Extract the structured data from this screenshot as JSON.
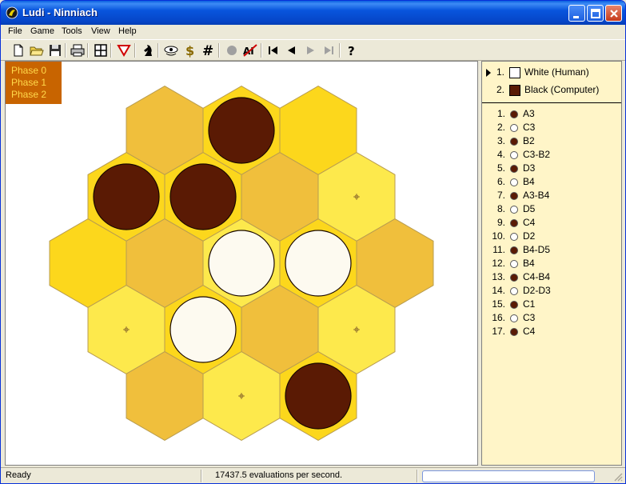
{
  "window": {
    "title": "Ludi - Ninniach"
  },
  "menu": [
    "File",
    "Game",
    "Tools",
    "View",
    "Help"
  ],
  "toolbar": {
    "buttons": [
      {
        "name": "new-button",
        "icon": "new-file-icon"
      },
      {
        "name": "open-button",
        "icon": "open-folder-icon"
      },
      {
        "name": "save-button",
        "icon": "floppy-disk-icon"
      },
      {
        "name": "print-button",
        "icon": "printer-icon"
      },
      {
        "name": "board-button",
        "icon": "grid-board-icon"
      },
      {
        "name": "swap-button",
        "icon": "triangle-down-icon"
      },
      {
        "name": "player-button",
        "icon": "knight-icon"
      },
      {
        "name": "hint-button",
        "icon": "eye-hand-icon"
      },
      {
        "name": "score-button",
        "icon": "dollar-icon"
      },
      {
        "name": "coordinates-button",
        "icon": "hash-icon"
      },
      {
        "name": "stop-button",
        "icon": "stop-circle-icon"
      },
      {
        "name": "ai-off-button",
        "icon": "ai-crossed-icon"
      },
      {
        "name": "first-move-button",
        "icon": "skip-back-icon"
      },
      {
        "name": "prev-move-button",
        "icon": "step-back-icon"
      },
      {
        "name": "next-move-button",
        "icon": "step-forward-icon"
      },
      {
        "name": "last-move-button",
        "icon": "skip-forward-icon"
      },
      {
        "name": "help-button",
        "icon": "question-icon"
      }
    ]
  },
  "phases": [
    "Phase 0",
    "Phase 1",
    "Phase 2"
  ],
  "colors": {
    "hex_light": "#f0bf3c",
    "hex_bright": "#fcd71c",
    "hex_yellow": "#fde94c",
    "hex_border": "#b89c50",
    "black_piece": "#5a1a04",
    "white_piece": "#fdfaf0",
    "phase_bg": "#c86400",
    "phase_text": "#ffd84a",
    "side_bg": "#fff5c8"
  },
  "board": {
    "pieces_note_hidden": "",
    "cells": [
      {
        "id": "c1",
        "shade": "light",
        "piece": "none"
      },
      {
        "id": "c2",
        "shade": "bright",
        "piece": "black"
      },
      {
        "id": "c3",
        "shade": "bright",
        "piece": "none"
      },
      {
        "id": "c4",
        "shade": "bright",
        "piece": "black"
      },
      {
        "id": "c5",
        "shade": "bright",
        "piece": "black"
      },
      {
        "id": "c6",
        "shade": "light",
        "piece": "none"
      },
      {
        "id": "c7",
        "shade": "yellow",
        "piece": "marker"
      },
      {
        "id": "c8",
        "shade": "bright",
        "piece": "none"
      },
      {
        "id": "c9",
        "shade": "light",
        "piece": "none"
      },
      {
        "id": "c10",
        "shade": "yellow",
        "piece": "white"
      },
      {
        "id": "c11",
        "shade": "bright",
        "piece": "white"
      },
      {
        "id": "c12",
        "shade": "light",
        "piece": "none"
      },
      {
        "id": "c13",
        "shade": "yellow",
        "piece": "marker"
      },
      {
        "id": "c14",
        "shade": "bright",
        "piece": "white"
      },
      {
        "id": "c15",
        "shade": "light",
        "piece": "none"
      },
      {
        "id": "c16",
        "shade": "yellow",
        "piece": "marker"
      },
      {
        "id": "c17",
        "shade": "light",
        "piece": "none"
      },
      {
        "id": "c18",
        "shade": "yellow",
        "piece": "marker"
      },
      {
        "id": "c19",
        "shade": "bright",
        "piece": "black"
      }
    ]
  },
  "players": [
    {
      "num": "1.",
      "name": "White (Human)",
      "color": "#ffffff",
      "active": true
    },
    {
      "num": "2.",
      "name": "Black (Computer)",
      "color": "#5a1a04",
      "active": false
    }
  ],
  "moves": [
    {
      "num": "1.",
      "side": "black",
      "text": "A3"
    },
    {
      "num": "2.",
      "side": "white",
      "text": "C3"
    },
    {
      "num": "3.",
      "side": "black",
      "text": "B2"
    },
    {
      "num": "4.",
      "side": "white",
      "text": "C3-B2"
    },
    {
      "num": "5.",
      "side": "black",
      "text": "D3"
    },
    {
      "num": "6.",
      "side": "white",
      "text": "B4"
    },
    {
      "num": "7.",
      "side": "black",
      "text": "A3-B4"
    },
    {
      "num": "8.",
      "side": "white",
      "text": "D5"
    },
    {
      "num": "9.",
      "side": "black",
      "text": "C4"
    },
    {
      "num": "10.",
      "side": "white",
      "text": "D2"
    },
    {
      "num": "11.",
      "side": "black",
      "text": "B4-D5"
    },
    {
      "num": "12.",
      "side": "white",
      "text": "B4"
    },
    {
      "num": "13.",
      "side": "black",
      "text": "C4-B4"
    },
    {
      "num": "14.",
      "side": "white",
      "text": "D2-D3"
    },
    {
      "num": "15.",
      "side": "black",
      "text": "C1"
    },
    {
      "num": "16.",
      "side": "white",
      "text": "C3"
    },
    {
      "num": "17.",
      "side": "black",
      "text": "C4"
    }
  ],
  "status": {
    "left": "Ready",
    "middle": "17437.5 evaluations per second."
  }
}
